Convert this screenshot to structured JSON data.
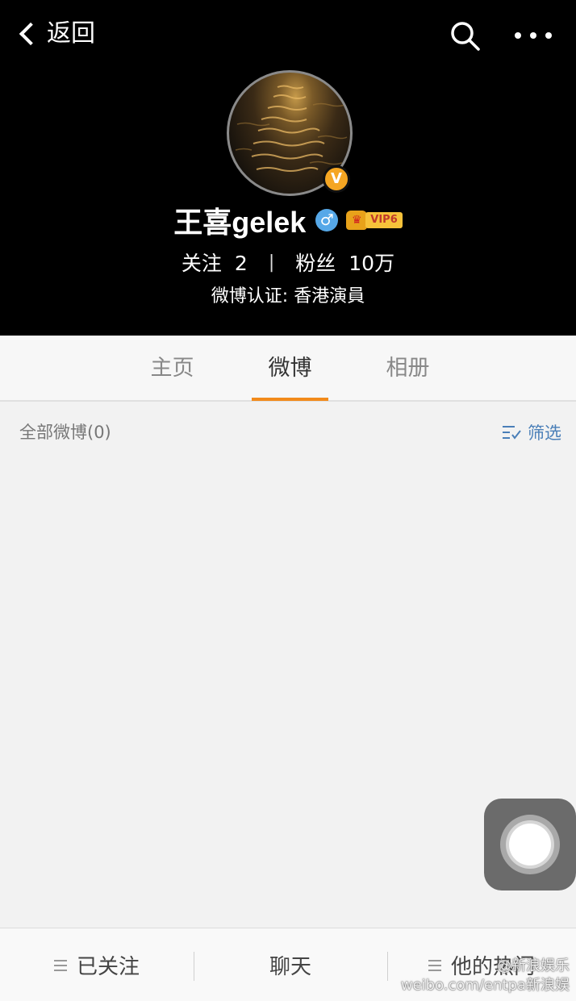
{
  "header": {
    "back_label": "返回",
    "name": "王喜gelek",
    "gender_symbol": "♂",
    "verified_badge": "V",
    "vip_level": "VIP6",
    "following_label": "关注",
    "following_count": "2",
    "separator": "|",
    "fans_label": "粉丝",
    "fans_count": "10万",
    "verification": "微博认证: 香港演員"
  },
  "tabs": [
    {
      "label": "主页"
    },
    {
      "label": "微博",
      "active": true
    },
    {
      "label": "相册"
    }
  ],
  "filter": {
    "all_label": "全部微博(0)",
    "filter_label": "筛选"
  },
  "bottom_bar": {
    "followed_label": "已关注",
    "chat_label": "聊天",
    "hot_label": "他的热门"
  },
  "watermark": {
    "line1": "@新浪娱乐",
    "line2": "weibo.com/entpa新浪娱"
  },
  "colors": {
    "accent": "#f28a1b",
    "link": "#4a7fb8",
    "header_bg": "#000000",
    "gender_blue": "#56a8e8",
    "vip_gold": "#f7c23a"
  },
  "icons": [
    "back-chevron-icon",
    "search-icon",
    "more-dots-icon",
    "verified-v-icon",
    "male-icon",
    "vip-crown-icon",
    "filter-icon",
    "menu-icon",
    "assistive-touch-icon"
  ]
}
